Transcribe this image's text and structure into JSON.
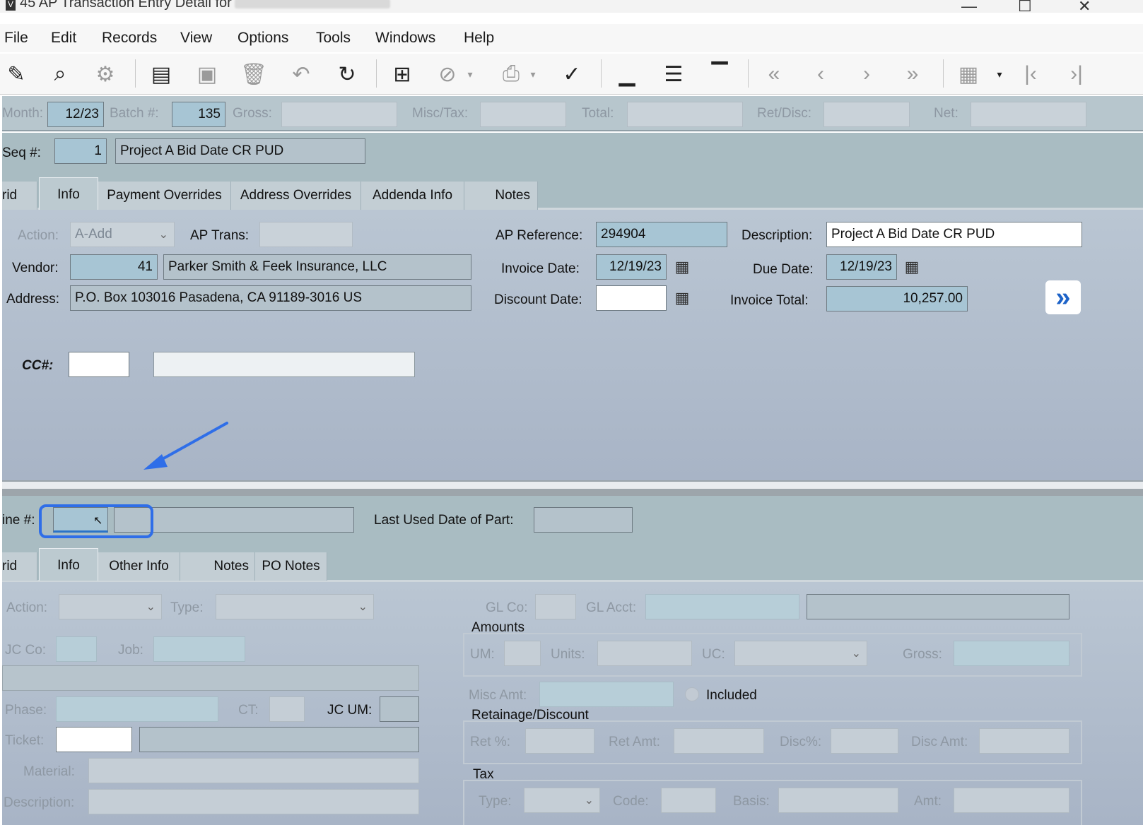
{
  "window": {
    "title": "45 AP Transaction Entry Detail for",
    "min": "—",
    "max": "☐",
    "close": "✕"
  },
  "menu": [
    "File",
    "Edit",
    "Records",
    "View",
    "Options",
    "Tools",
    "Windows",
    "Help"
  ],
  "header": {
    "month_label": "Month:",
    "month_value": "12/23",
    "batch_label": "Batch #:",
    "batch_value": "135",
    "gross_label": "Gross:",
    "misc_tax_label": "Misc/Tax:",
    "total_label": "Total:",
    "ret_disc_label": "Ret/Disc:",
    "net_label": "Net:",
    "seq_label": "Seq #:",
    "seq_value": "1",
    "seq_desc": "Project A Bid Date CR PUD"
  },
  "tabs_top": [
    "rid",
    "Info",
    "Payment Overrides",
    "Address Overrides",
    "Addenda Info",
    "Notes"
  ],
  "info": {
    "action_label": "Action:",
    "action_value": "A-Add",
    "ap_trans_label": "AP Trans:",
    "vendor_label": "Vendor:",
    "vendor_no": "41",
    "vendor_name": "Parker Smith & Feek Insurance, LLC",
    "address_label": "Address:",
    "address_value": "P.O. Box 103016  Pasadena, CA  91189-3016  US",
    "ap_ref_label": "AP Reference:",
    "ap_ref_value": "294904",
    "invoice_date_label": "Invoice Date:",
    "invoice_date_value": "12/19/23",
    "discount_date_label": "Discount Date:",
    "description_label": "Description:",
    "description_value": "Project A Bid Date CR PUD",
    "due_date_label": "Due Date:",
    "due_date_value": "12/19/23",
    "invoice_total_label": "Invoice Total:",
    "invoice_total_value": "10,257.00",
    "cc_label": "CC#:"
  },
  "line": {
    "line_label": "ine #:",
    "last_used_label": "Last Used Date of Part:"
  },
  "tabs_bottom": [
    "rid",
    "Info",
    "Other Info",
    "Notes",
    "PO Notes"
  ],
  "detail": {
    "action_label": "Action:",
    "type_label": "Type:",
    "jc_co_label": "JC Co:",
    "job_label": "Job:",
    "phase_label": "Phase:",
    "ct_label": "CT:",
    "jc_um_label": "JC UM:",
    "ticket_label": "Ticket:",
    "material_label": "Material:",
    "description_label": "Description:",
    "gl_co_label": "GL Co:",
    "gl_acct_label": "GL Acct:",
    "amounts_title": "Amounts",
    "um_label": "UM:",
    "units_label": "Units:",
    "uc_label": "UC:",
    "gross_label": "Gross:",
    "misc_amt_label": "Misc Amt:",
    "included_label": "Included",
    "ret_disc_title": "Retainage/Discount",
    "ret_pct_label": "Ret %:",
    "ret_amt_label": "Ret Amt:",
    "disc_pct_label": "Disc%:",
    "disc_amt_label": "Disc Amt:",
    "tax_title": "Tax",
    "tax_type_label": "Type:",
    "code_label": "Code:",
    "basis_label": "Basis:",
    "amt_label": "Amt:"
  },
  "icons": {
    "calendar": "calendar-icon",
    "next": "double-chevron-right-icon"
  },
  "colors": {
    "header_band": "#b7c6cd",
    "field_blue": "#a7c5d4",
    "highlight": "#2f6ee8",
    "arrow": "#2f6ee8"
  }
}
